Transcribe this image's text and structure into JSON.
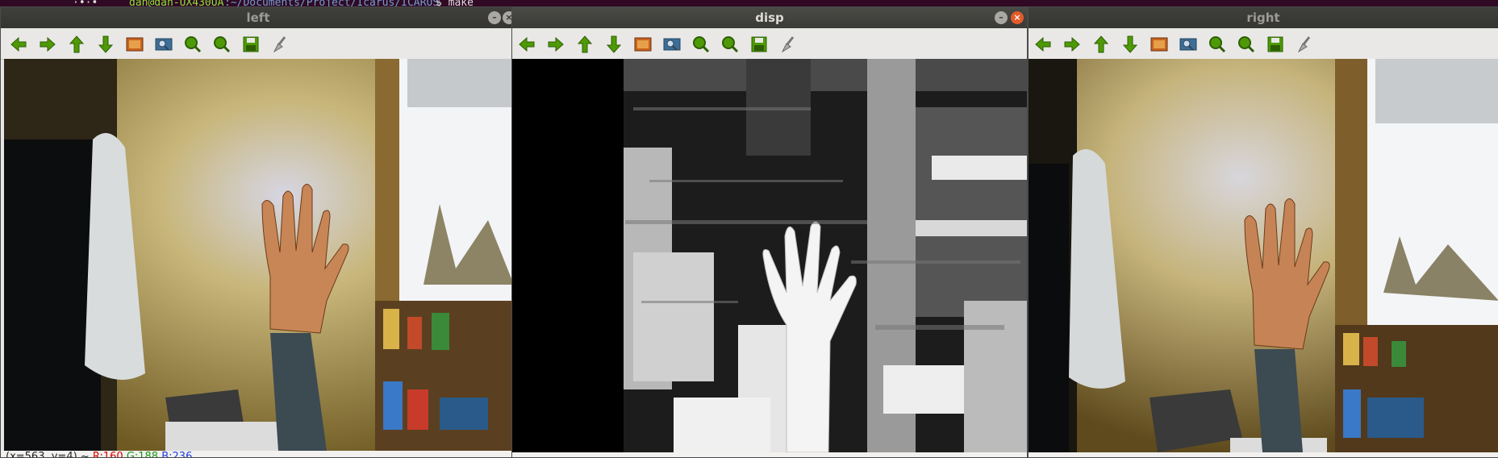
{
  "terminal": {
    "prefix": "·•·•",
    "prompt": "dan@dan-UX430UA",
    "path": ":~/Documents/Project/Icarus/ICARUS",
    "command": "$ make"
  },
  "windows": {
    "left": {
      "title": "left",
      "status": {
        "coords": "(x=563, y=4) ~",
        "r": "R:160",
        "g": "G:188",
        "b": "B:236"
      }
    },
    "disp": {
      "title": "disp"
    },
    "right": {
      "title": "right"
    }
  },
  "toolbar_icons": [
    "arrow-left-icon",
    "arrow-right-icon",
    "arrow-up-icon",
    "arrow-down-icon",
    "image-icon",
    "zoom-fit-icon",
    "zoom-in-icon",
    "zoom-out-icon",
    "save-icon",
    "properties-brush-icon"
  ],
  "colors": {
    "arrow_green": "#4e9a06",
    "status_r": "#e00000",
    "status_g": "#1a9a1a",
    "status_b": "#2040e0"
  }
}
